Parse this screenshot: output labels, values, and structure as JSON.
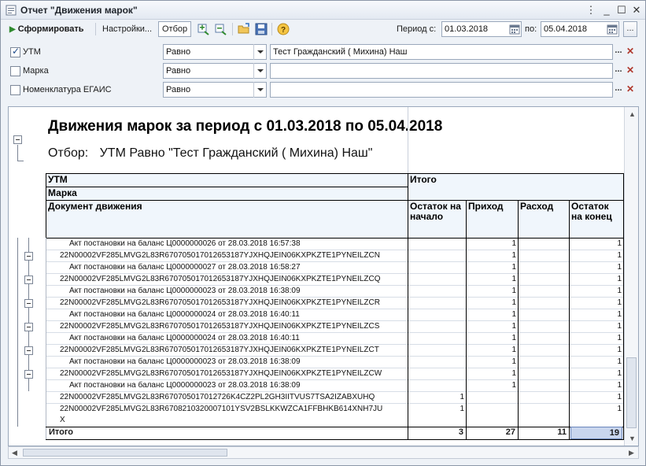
{
  "window": {
    "title": "Отчет \"Движения марок\""
  },
  "toolbar": {
    "generate_label": "Сформировать",
    "settings_label": "Настройки...",
    "filter_label": "Отбор",
    "period_from_label": "Период с:",
    "period_from_value": "01.03.2018",
    "period_to_label": "по:",
    "period_to_value": "05.04.2018"
  },
  "filters": [
    {
      "label": "УТМ",
      "checked": true,
      "condition": "Равно",
      "value": "Тест Гражданский ( Михина) Наш"
    },
    {
      "label": "Марка",
      "checked": false,
      "condition": "Равно",
      "value": ""
    },
    {
      "label": "Номенклатура ЕГАИС",
      "checked": false,
      "condition": "Равно",
      "value": ""
    }
  ],
  "report": {
    "title": "Движения марок за период с 01.03.2018 по 05.04.2018",
    "filter_prefix": "Отбор:",
    "filter_text": "УТМ Равно \"Тест Гражданский ( Михина) Наш\"",
    "headers": {
      "utm": "УТМ",
      "mark": "Марка",
      "doc": "Документ движения",
      "total": "Итого",
      "start": "Остаток на начало",
      "in": "Приход",
      "out": "Расход",
      "end": "Остаток на конец"
    },
    "rows": [
      {
        "text": "Акт постановки на баланс Ц0000000026 от 28.03.2018 16:57:38",
        "level": 2,
        "start": "",
        "in": "1",
        "out": "",
        "end": "1"
      },
      {
        "text": "22N00002VF285LMVG2L83R670705017012653187YJXHQJEIN06KXPKZTE1PYNEILZCN",
        "level": 1,
        "start": "",
        "in": "1",
        "out": "",
        "end": "1"
      },
      {
        "text": "Акт постановки на баланс Ц0000000027 от 28.03.2018 16:58:27",
        "level": 2,
        "start": "",
        "in": "1",
        "out": "",
        "end": "1"
      },
      {
        "text": "22N00002VF285LMVG2L83R670705017012653187YJXHQJEIN06KXPKZTE1PYNEILZCQ",
        "level": 1,
        "start": "",
        "in": "1",
        "out": "",
        "end": "1"
      },
      {
        "text": "Акт постановки на баланс Ц0000000023 от 28.03.2018 16:38:09",
        "level": 2,
        "start": "",
        "in": "1",
        "out": "",
        "end": "1"
      },
      {
        "text": "22N00002VF285LMVG2L83R670705017012653187YJXHQJEIN06KXPKZTE1PYNEILZCR",
        "level": 1,
        "start": "",
        "in": "1",
        "out": "",
        "end": "1"
      },
      {
        "text": "Акт постановки на баланс Ц0000000024 от 28.03.2018 16:40:11",
        "level": 2,
        "start": "",
        "in": "1",
        "out": "",
        "end": "1"
      },
      {
        "text": "22N00002VF285LMVG2L83R670705017012653187YJXHQJEIN06KXPKZTE1PYNEILZCS",
        "level": 1,
        "start": "",
        "in": "1",
        "out": "",
        "end": "1"
      },
      {
        "text": "Акт постановки на баланс Ц0000000024 от 28.03.2018 16:40:11",
        "level": 2,
        "start": "",
        "in": "1",
        "out": "",
        "end": "1"
      },
      {
        "text": "22N00002VF285LMVG2L83R670705017012653187YJXHQJEIN06KXPKZTE1PYNEILZCT",
        "level": 1,
        "start": "",
        "in": "1",
        "out": "",
        "end": "1"
      },
      {
        "text": "Акт постановки на баланс Ц0000000023 от 28.03.2018 16:38:09",
        "level": 2,
        "start": "",
        "in": "1",
        "out": "",
        "end": "1"
      },
      {
        "text": "22N00002VF285LMVG2L83R670705017012653187YJXHQJEIN06KXPKZTE1PYNEILZCW",
        "level": 1,
        "start": "",
        "in": "1",
        "out": "",
        "end": "1"
      },
      {
        "text": "Акт постановки на баланс Ц0000000023 от 28.03.2018 16:38:09",
        "level": 2,
        "start": "",
        "in": "1",
        "out": "",
        "end": "1"
      },
      {
        "text": "22N00002VF285LMVG2L83R670705017012726K4CZ2PL2GH3IITVUS7TSA2IZABXUHQ",
        "level": 1,
        "start": "1",
        "in": "",
        "out": "",
        "end": "1"
      },
      {
        "text": "22N00002VF285LMVG2L83R6708210320007101YSV2BSLKKWZCA1FFBHKB614XNH7JU",
        "text2": "X",
        "level": 1,
        "start": "1",
        "in": "",
        "out": "",
        "end": "1"
      }
    ],
    "total": {
      "label": "Итого",
      "start": "3",
      "in": "27",
      "out": "11",
      "end": "19"
    }
  }
}
